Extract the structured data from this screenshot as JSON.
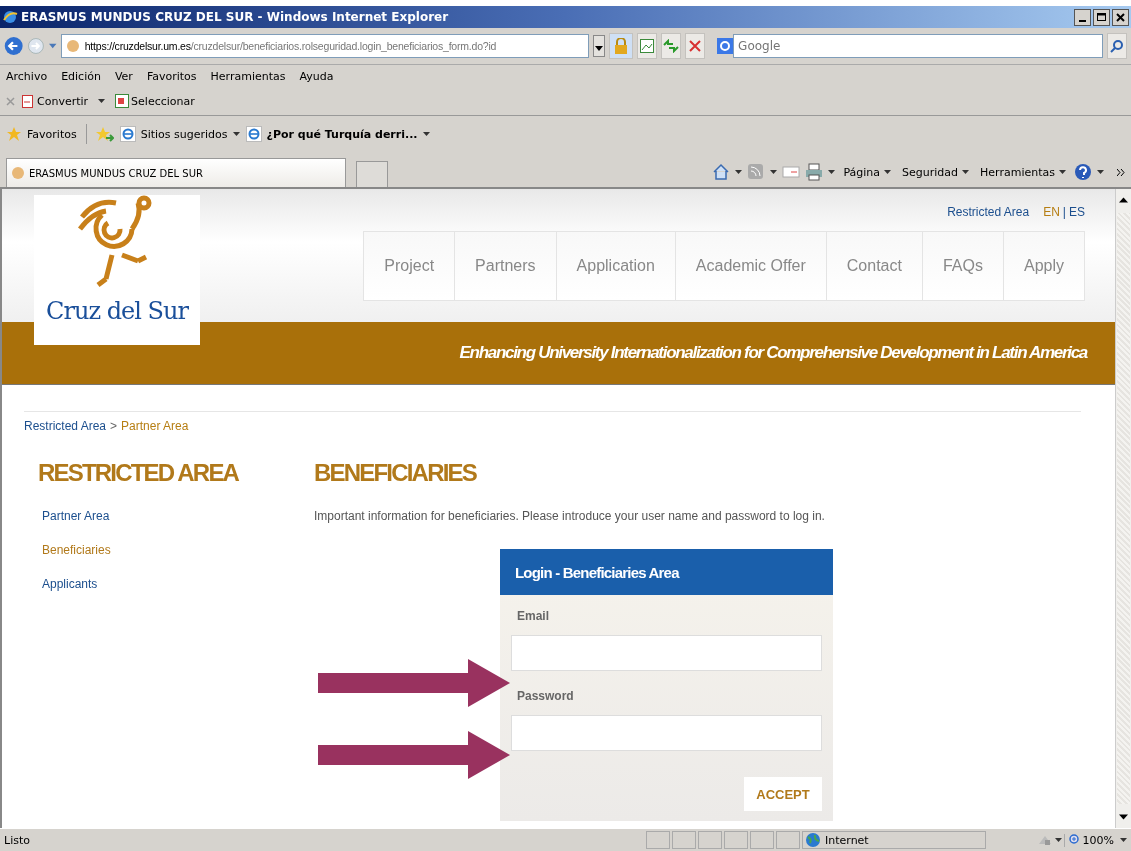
{
  "window": {
    "title": "ERASMUS MUNDUS CRUZ DEL SUR - Windows Internet Explorer"
  },
  "address_bar": {
    "host": "https://cruzdelsur.um.es",
    "path": "/cruzdelsur/beneficiarios.rolseguridad.login_beneficiarios_form.do?id"
  },
  "search": {
    "placeholder": "Google"
  },
  "menu": [
    "Archivo",
    "Edición",
    "Ver",
    "Favoritos",
    "Herramientas",
    "Ayuda"
  ],
  "command_bar": [
    "Convertir",
    "Seleccionar"
  ],
  "favorites_bar": {
    "label": "Favoritos",
    "items": [
      {
        "label": "Sitios sugeridos",
        "bold": false
      },
      {
        "label": "¿Por qué Turquía derri...",
        "bold": true
      }
    ]
  },
  "tab": {
    "title": "ERASMUS MUNDUS CRUZ DEL SUR"
  },
  "tools": [
    "Página",
    "Seguridad",
    "Herramientas"
  ],
  "page": {
    "top_link": "Restricted Area",
    "languages": [
      {
        "label": "EN",
        "selected": true
      },
      {
        "label": "ES",
        "selected": false
      }
    ],
    "language_separator": "|",
    "logo_text": "Cruz del Sur",
    "nav": [
      "Project",
      "Partners",
      "Application",
      "Academic Offer",
      "Contact",
      "FAQs",
      "Apply"
    ],
    "tagline": "Enhancing University Internationalization for Comprehensive Development in Latin America",
    "breadcrumb": {
      "items": [
        "Restricted Area",
        "Partner Area"
      ],
      "separator": ">"
    },
    "sidebar": {
      "title": "RESTRICTED AREA",
      "items": [
        {
          "label": "Partner Area",
          "selected": false
        },
        {
          "label": "Beneficiaries",
          "selected": true
        },
        {
          "label": "Applicants",
          "selected": false
        }
      ]
    },
    "heading": "BENEFICIARIES",
    "intro": "Important information for beneficiaries. Please introduce your user name and password to log in.",
    "login": {
      "title": "Login - Beneficiaries Area",
      "fields": [
        {
          "label": "Email"
        },
        {
          "label": "Password"
        }
      ],
      "button": "ACCEPT"
    }
  },
  "status_bar": {
    "text": "Listo",
    "zone": "Internet",
    "zoom": "100%"
  }
}
